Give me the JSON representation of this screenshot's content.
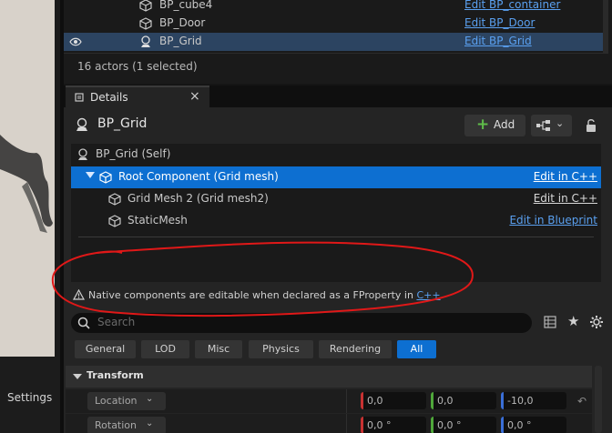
{
  "viewport": {
    "settings_label": "Settings"
  },
  "outliner": {
    "rows": [
      {
        "name": "BP_cube4",
        "edit": "Edit BP_container"
      },
      {
        "name": "BP_Door",
        "edit": "Edit BP_Door"
      },
      {
        "name": "BP_Grid",
        "edit": "Edit BP_Grid",
        "selected": true
      }
    ],
    "status": "16 actors (1 selected)"
  },
  "details": {
    "tab_label": "Details",
    "tab_close": "×",
    "actor_name": "BP_Grid",
    "add_label": "Add",
    "add_plus": "+",
    "components": [
      {
        "name": "BP_Grid (Self)",
        "edit": ""
      },
      {
        "name": "Root Component (Grid mesh)",
        "edit": "Edit in C++"
      },
      {
        "name": "Grid Mesh 2 (Grid mesh2)",
        "edit": "Edit in C++"
      },
      {
        "name": "StaticMesh",
        "edit": "Edit in Blueprint"
      }
    ],
    "note_text": "Native components are editable when declared as a FProperty in ",
    "note_link": "C++",
    "search_placeholder": "Search",
    "filters": [
      "General",
      "LOD",
      "Misc",
      "Physics",
      "Rendering",
      "All"
    ],
    "active_filter": "All",
    "section_title": "Transform",
    "properties": [
      {
        "label": "Location",
        "values": [
          "0,0",
          "0,0",
          "-10,0"
        ]
      },
      {
        "label": "Rotation",
        "values": [
          "0,0 °",
          "0,0 °",
          "0,0 °"
        ]
      }
    ]
  },
  "colors": {
    "selection": "#0d6fd1",
    "link": "#5aa0f0",
    "annotation": "#e01818",
    "axis_x": "#c83232",
    "axis_y": "#4fa83a",
    "axis_z": "#3a6fd8"
  },
  "icons": [
    "eye-icon",
    "cube-icon",
    "pawn-icon",
    "plus-icon",
    "blueprint-icon",
    "lock-icon",
    "search-icon",
    "grid-view-icon",
    "star-icon",
    "gear-icon",
    "warning-icon",
    "reset-icon"
  ]
}
